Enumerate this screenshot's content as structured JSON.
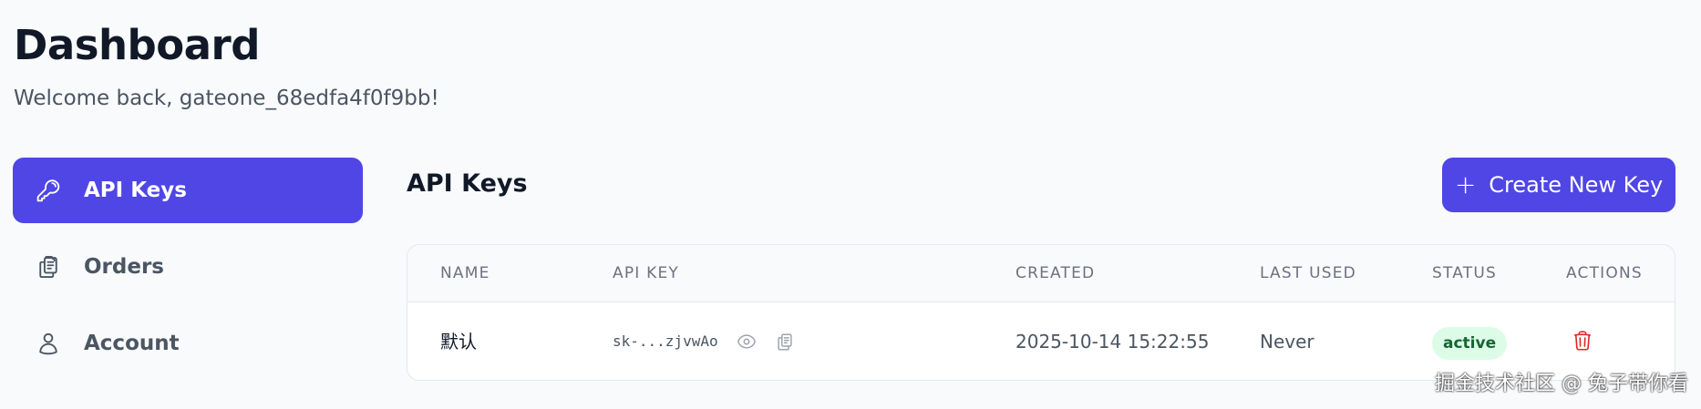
{
  "header": {
    "title": "Dashboard",
    "welcome": "Welcome back, gateone_68edfa4f0f9bb!"
  },
  "sidebar": {
    "items": [
      {
        "label": "API Keys",
        "icon": "key-icon",
        "active": true
      },
      {
        "label": "Orders",
        "icon": "clipboard-icon",
        "active": false
      },
      {
        "label": "Account",
        "icon": "user-icon",
        "active": false
      }
    ]
  },
  "main": {
    "title": "API Keys",
    "create_button": "Create New Key",
    "table": {
      "columns": [
        "NAME",
        "API KEY",
        "CREATED",
        "LAST USED",
        "STATUS",
        "ACTIONS"
      ],
      "rows": [
        {
          "name": "默认",
          "api_key": "sk-...zjvwAo",
          "created": "2025-10-14 15:22:55",
          "last_used": "Never",
          "status": "active"
        }
      ]
    }
  },
  "watermark": "掘金技术社区 @ 兔子带你看",
  "colors": {
    "accent": "#4f46e5",
    "status_active_bg": "#dcfce7",
    "status_active_text": "#166534",
    "danger": "#dc2626"
  }
}
